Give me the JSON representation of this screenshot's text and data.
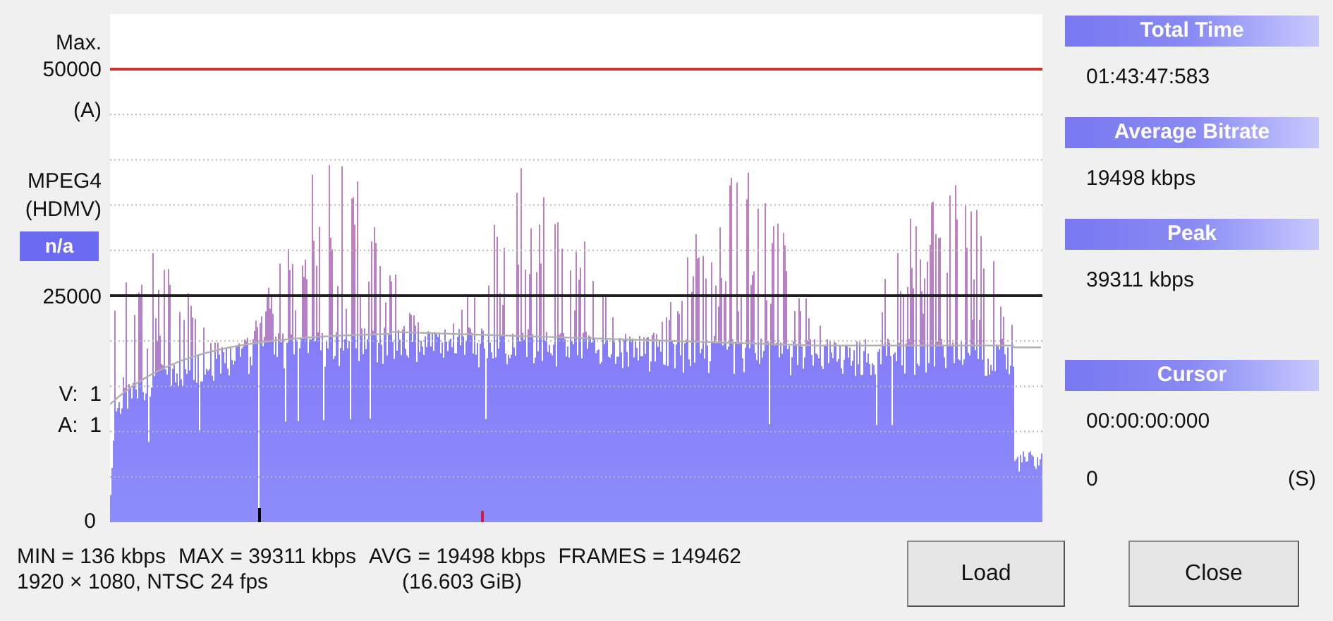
{
  "axis_labels": {
    "max_caption": "Max.",
    "max_value": "50000",
    "max_unit": "(A)",
    "mid_value": "25000",
    "zero": "0"
  },
  "codec": {
    "name": "MPEG4",
    "format": "(HDMV)",
    "badge": "n/a"
  },
  "tracks": [
    {
      "label": "V:",
      "value": "1"
    },
    {
      "label": "A:",
      "value": "1"
    }
  ],
  "summary": [
    "MIN = 136 kbps",
    "MAX = 39311 kbps",
    "AVG = 19498 kbps",
    "FRAMES = 149462"
  ],
  "video_info": {
    "format": "1920 × 1080, NTSC 24 fps",
    "size": "(16.603 GiB)"
  },
  "panels": [
    {
      "title": "Total Time",
      "lines": [
        {
          "value": "01:43:47:583"
        }
      ]
    },
    {
      "title": "Average Bitrate",
      "lines": [
        {
          "value": "19498 kbps"
        }
      ]
    },
    {
      "title": "Peak",
      "lines": [
        {
          "value": "39311 kbps"
        }
      ]
    },
    {
      "title": "Cursor",
      "lines": [
        {
          "value": "00:00:00:000"
        },
        {
          "value": "0",
          "unit": "(S)"
        }
      ]
    }
  ],
  "buttons": [
    "Load",
    "Close"
  ]
}
